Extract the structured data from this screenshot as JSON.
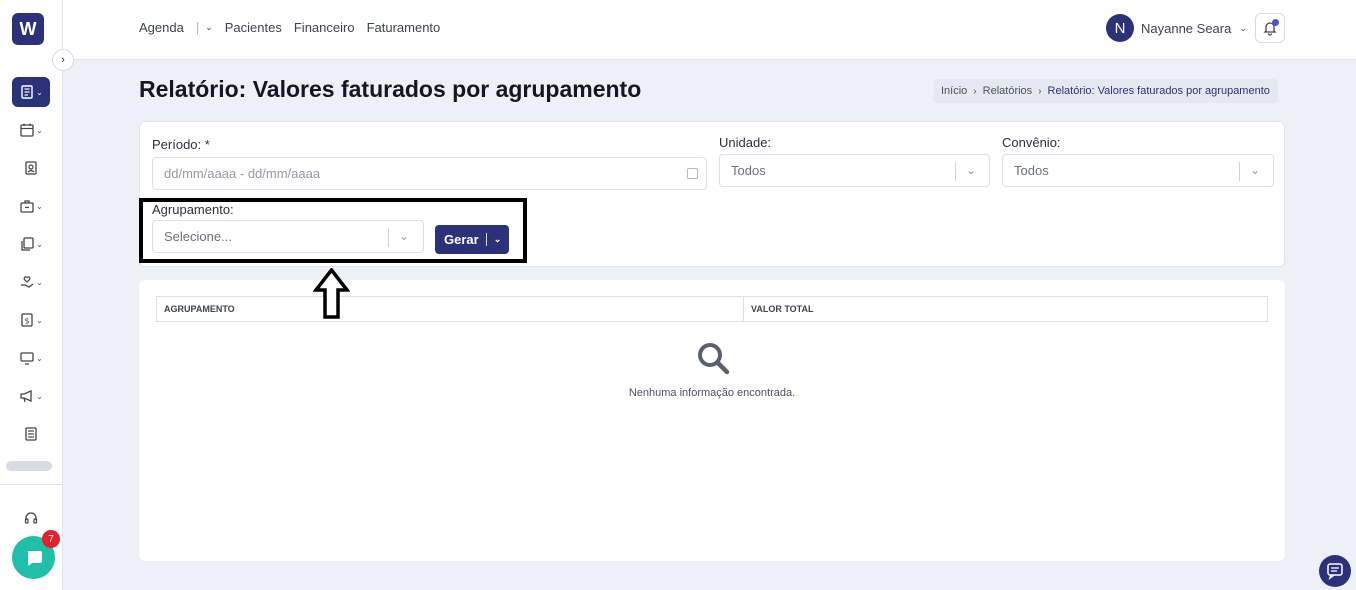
{
  "app": {
    "logo_text": "W"
  },
  "topnav": {
    "items": [
      "Agenda",
      "Pacientes",
      "Financeiro",
      "Faturamento"
    ],
    "user": {
      "initial": "N",
      "name": "Nayanne Seara"
    }
  },
  "page": {
    "title": "Relatório: Valores faturados por agrupamento",
    "breadcrumb": [
      "Início",
      "Relatórios",
      "Relatório: Valores faturados por agrupamento"
    ]
  },
  "filters": {
    "periodo": {
      "label": "Período: *",
      "placeholder": "dd/mm/aaaa - dd/mm/aaaa"
    },
    "unidade": {
      "label": "Unidade:",
      "value": "Todos"
    },
    "convenio": {
      "label": "Convênio:",
      "value": "Todos"
    },
    "agrupamento": {
      "label": "Agrupamento:",
      "placeholder": "Selecione..."
    },
    "gerar_label": "Gerar"
  },
  "table": {
    "columns": [
      "AGRUPAMENTO",
      "VALOR TOTAL"
    ],
    "empty_message": "Nenhuma informação encontrada."
  },
  "chat": {
    "badge_count": "7"
  },
  "colors": {
    "primary": "#2b327a",
    "chat": "#1fbfa8",
    "badge": "#e5202d"
  }
}
